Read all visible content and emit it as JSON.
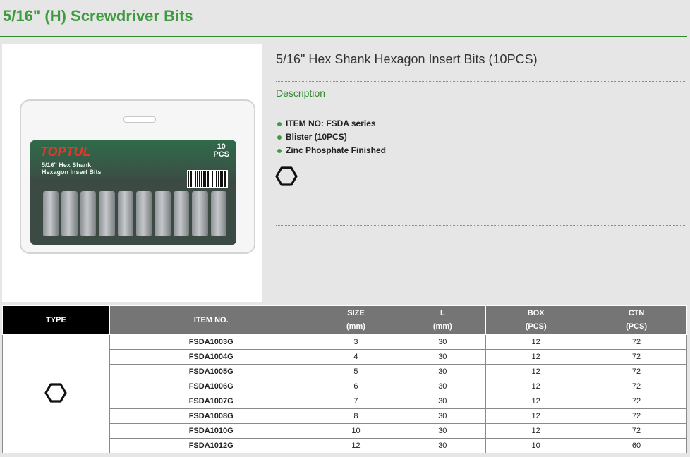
{
  "page": {
    "title": "5/16\" (H) Screwdriver Bits"
  },
  "product": {
    "name": "5/16\" Hex Shank Hexagon Insert Bits (10PCS)",
    "description_label": "Description",
    "features": [
      "ITEM NO: FSDA series",
      "Blister (10PCS)",
      "Zinc Phosphate Finished"
    ],
    "type_icon": "hexagon-icon",
    "image": {
      "brand": "TOPTUL",
      "card_line1": "5/16\" Hex Shank",
      "card_line2": "Hexagon Insert Bits",
      "qty_top": "10",
      "qty_bottom": "PCS"
    }
  },
  "table": {
    "headers": [
      {
        "line1": "TYPE",
        "line2": ""
      },
      {
        "line1": "ITEM NO.",
        "line2": ""
      },
      {
        "line1": "SIZE",
        "line2": "(mm)"
      },
      {
        "line1": "L",
        "line2": "(mm)"
      },
      {
        "line1": "BOX",
        "line2": "(PCS)"
      },
      {
        "line1": "CTN",
        "line2": "(PCS)"
      }
    ],
    "rows": [
      [
        "FSDA1003G",
        "3",
        "30",
        "12",
        "72"
      ],
      [
        "FSDA1004G",
        "4",
        "30",
        "12",
        "72"
      ],
      [
        "FSDA1005G",
        "5",
        "30",
        "12",
        "72"
      ],
      [
        "FSDA1006G",
        "6",
        "30",
        "12",
        "72"
      ],
      [
        "FSDA1007G",
        "7",
        "30",
        "12",
        "72"
      ],
      [
        "FSDA1008G",
        "8",
        "30",
        "12",
        "72"
      ],
      [
        "FSDA1010G",
        "10",
        "30",
        "12",
        "72"
      ],
      [
        "FSDA1012G",
        "12",
        "30",
        "10",
        "60"
      ]
    ]
  },
  "colors": {
    "accent": "#3f9b3f",
    "header_gray": "#757575",
    "type_header": "#000000"
  }
}
